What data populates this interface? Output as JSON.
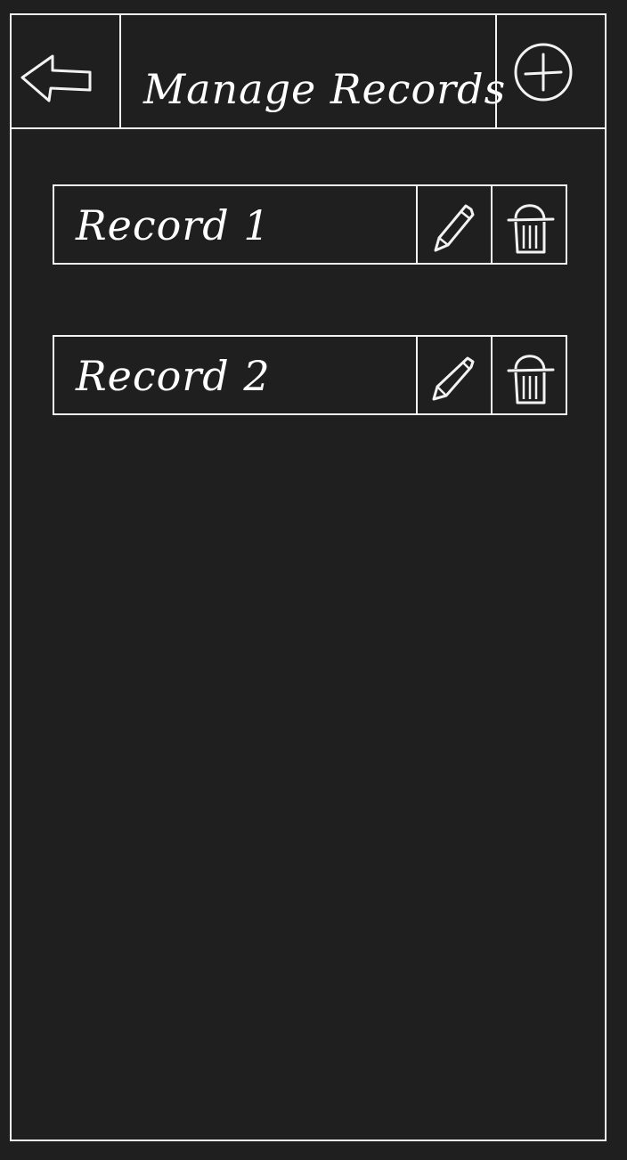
{
  "header": {
    "title": "Manage Records",
    "back_icon": "back-arrow-icon",
    "add_icon": "plus-circle-icon"
  },
  "records": [
    {
      "label": "Record 1",
      "edit_icon": "pencil-icon",
      "delete_icon": "trash-icon"
    },
    {
      "label": "Record 2",
      "edit_icon": "pencil-icon",
      "delete_icon": "trash-icon"
    }
  ],
  "colors": {
    "background": "#1f1f1f",
    "stroke": "#f2f2f2"
  }
}
